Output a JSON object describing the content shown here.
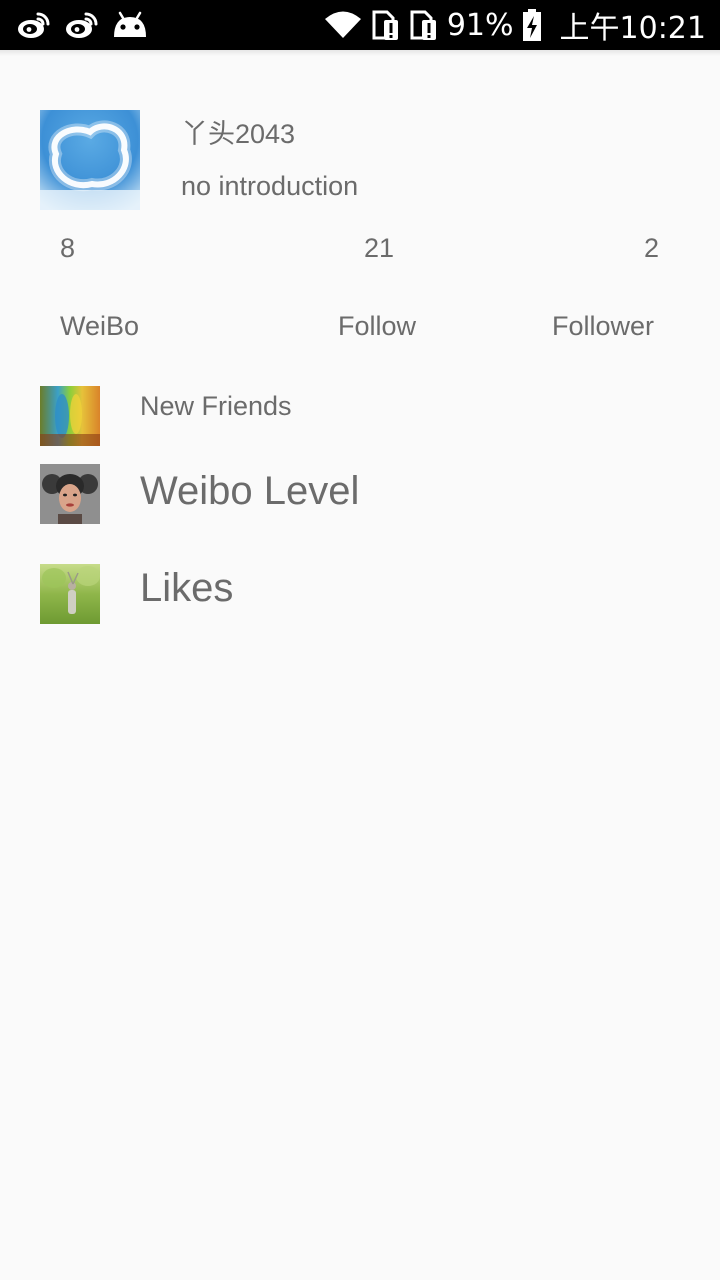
{
  "status_bar": {
    "left_icons": [
      "weibo-icon",
      "weibo-icon",
      "android-icon"
    ],
    "right_icons": [
      "wifi-icon",
      "sim-alert-icon",
      "sim-alert-icon",
      "battery-charging-icon"
    ],
    "battery_percent": "91%",
    "clock": "上午10:21"
  },
  "profile": {
    "username": "丫头2043",
    "introduction": "no introduction"
  },
  "stats": [
    {
      "count": "8",
      "label": "WeiBo"
    },
    {
      "count": "21",
      "label": "Follow"
    },
    {
      "count": "2",
      "label": "Follower"
    }
  ],
  "menu": [
    {
      "label": "New Friends"
    },
    {
      "label": "Weibo Level"
    },
    {
      "label": "Likes"
    }
  ],
  "colors": {
    "text": "#6b6b6b",
    "background": "#fafafa",
    "status_bar": "#000000"
  }
}
